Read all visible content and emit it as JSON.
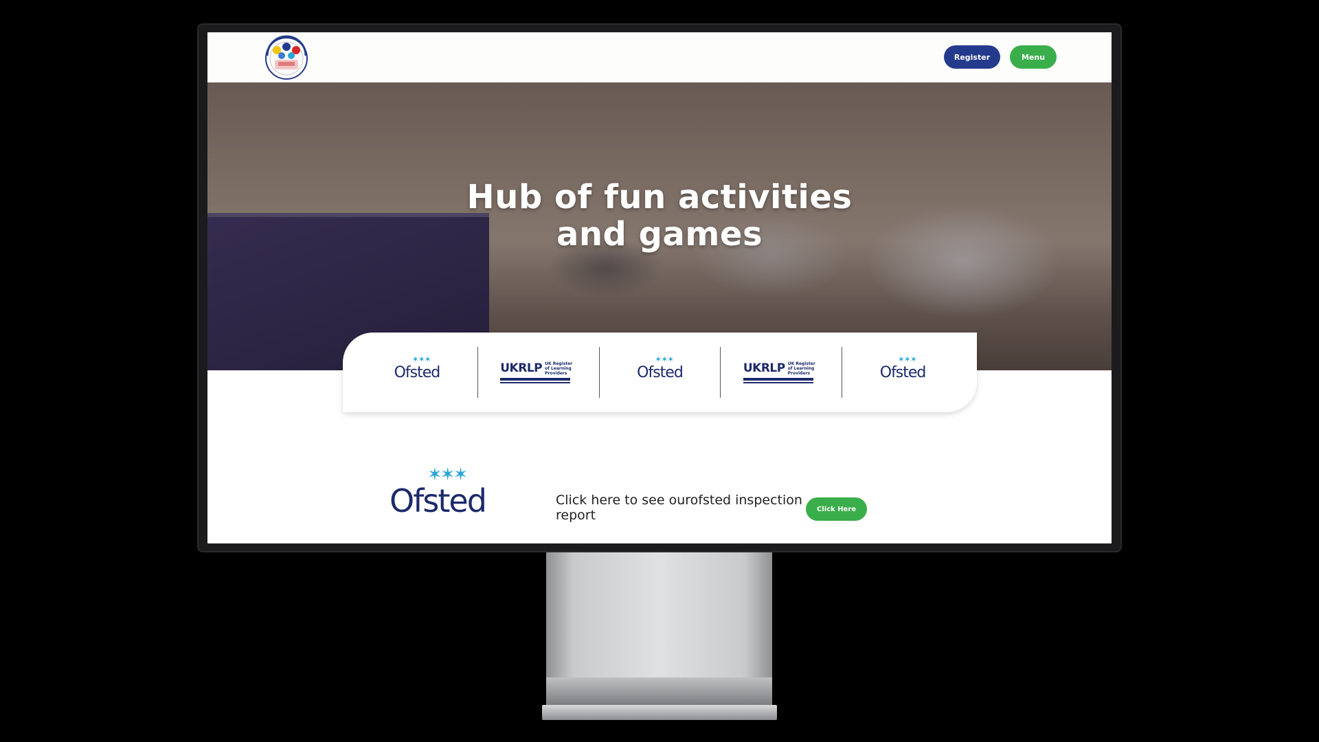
{
  "header": {
    "logo_alt": "New Age After School Club Ltd",
    "register_label": "Register",
    "menu_label": "Menu"
  },
  "hero": {
    "title_line1": "Hub of fun activities",
    "title_line2": "and games"
  },
  "accreditations": [
    {
      "type": "ofsted",
      "label": "Ofsted"
    },
    {
      "type": "ukrlp",
      "label": "UKRLP",
      "sub": "UK Register of Learning Providers"
    },
    {
      "type": "ofsted",
      "label": "Ofsted"
    },
    {
      "type": "ukrlp",
      "label": "UKRLP",
      "sub": "UK Register of Learning Providers"
    },
    {
      "type": "ofsted",
      "label": "Ofsted"
    }
  ],
  "report": {
    "logo_label": "Ofsted",
    "text": "Click here to see ourofsted inspection report",
    "button_label": "Click Here"
  },
  "colors": {
    "register": "#243a8c",
    "menu": "#3aae4a",
    "ofsted_navy": "#1c2a6b",
    "ofsted_star": "#2aa6d6"
  }
}
